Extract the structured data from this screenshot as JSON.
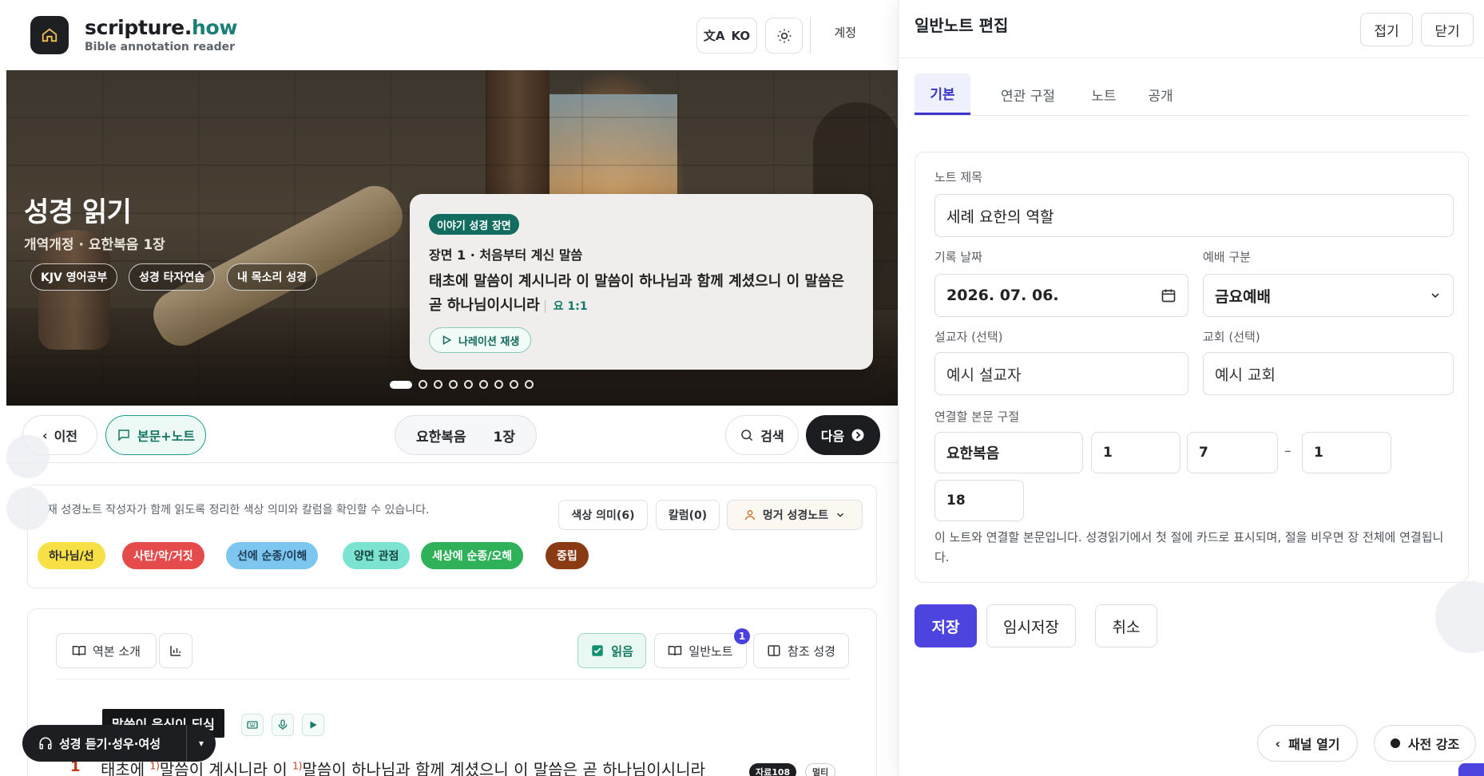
{
  "header": {
    "brand_main": "scripture.",
    "brand_accent": "how",
    "brand_sub": "Bible annotation reader",
    "lang_label": "KO",
    "account_label": "계정"
  },
  "hero": {
    "title": "성경 읽기",
    "subtitle": "개역개정 · 요한복음 1장",
    "pills": [
      "KJV 영어공부",
      "성경 타자연습",
      "내 목소리 성경"
    ],
    "card": {
      "badge": "이야기 성경 장면",
      "scene": "장면 1 · 처음부터 계신 말씀",
      "verse": "태초에 말씀이 계시니라 이 말씀이 하나님과 함께 계셨으니 이 말씀은 곧 하나님이시니라",
      "ref": "요 1:1",
      "button": "나레이션 재생"
    },
    "slide_count": 9,
    "active_slide": 1
  },
  "nav": {
    "prev": "이전",
    "text_note": "본문+노트",
    "book": "요한복음",
    "chapter": "1장",
    "search": "검색",
    "next": "다음"
  },
  "legend": {
    "description": "재 성경노트 작성자가 함께 읽도록 정리한 색상 의미와 칼럼을 확인할 수 있습니다.",
    "color_meaning": "색상 의미(6)",
    "column": "칼럼(0)",
    "author": "멍거 성경노트",
    "chips": [
      {
        "label": "하나님/선",
        "bg": "#f7e046",
        "fg": "#2b2b2b"
      },
      {
        "label": "사탄/악/거짓",
        "bg": "#e54b4b",
        "fg": "#ffffff"
      },
      {
        "label": "선에 순종/이해",
        "bg": "#7cc6ef",
        "fg": "#1d3a52"
      },
      {
        "label": "양면 관점",
        "bg": "#7ce2d1",
        "fg": "#1a4640"
      },
      {
        "label": "세상에 순종/오해",
        "bg": "#2fb15a",
        "fg": "#ffffff"
      },
      {
        "label": "중립",
        "bg": "#8a3b13",
        "fg": "#ffffff"
      }
    ]
  },
  "reader": {
    "intro": "역본 소개",
    "read": "읽음",
    "general_note": "일반노트",
    "note_count": "1",
    "reference": "참조 성경",
    "tooltip": "말씀이 육신이 되심",
    "verse_number": "1",
    "verse_part1": "태초에 ",
    "sup1": "1)",
    "verse_part2": "말씀이 계시니라 이 ",
    "sup2": "1)",
    "verse_part3": "말씀이 하나님과 함께 계셨으니 이 말씀은 곧 하나님이시니라",
    "verse_chip1": "자료108",
    "verse_chip2": "멀티"
  },
  "audio": {
    "label": "성경 듣기·성우·여성"
  },
  "panel": {
    "title": "일반노트 편집",
    "fold": "접기",
    "close": "닫기",
    "tabs": [
      "기본",
      "연관 구절",
      "노트",
      "공개"
    ],
    "fields": {
      "title_label": "노트 제목",
      "title_value": "세례 요한의 역할",
      "date_label": "기록 날짜",
      "date_value": "2026. 07. 06.",
      "service_label": "예배 구분",
      "service_value": "금요예배",
      "preacher_label": "설교자 (선택)",
      "preacher_placeholder": "예시 설교자",
      "church_label": "교회 (선택)",
      "church_placeholder": "예시 교회",
      "passage_label": "연결할 본문 구절",
      "book_value": "요한복음",
      "start_chapter": "1",
      "start_verse": "7",
      "range_sep": "–",
      "end_chapter": "1",
      "end_verse": "18"
    },
    "help": "이 노트와 연결할 본문입니다. 성경읽기에서 첫 절에 카드로 표시되며, 절을 비우면 장 전체에 연결됩니다.",
    "save": "저장",
    "temp_save": "임시저장",
    "cancel": "취소"
  },
  "floating": {
    "open_panel": "패널 열기",
    "dict_highlight": "사전 강조"
  },
  "colors": {
    "accent": "#4d44e0",
    "teal": "#1a7f76",
    "dark": "#1c1d20"
  }
}
